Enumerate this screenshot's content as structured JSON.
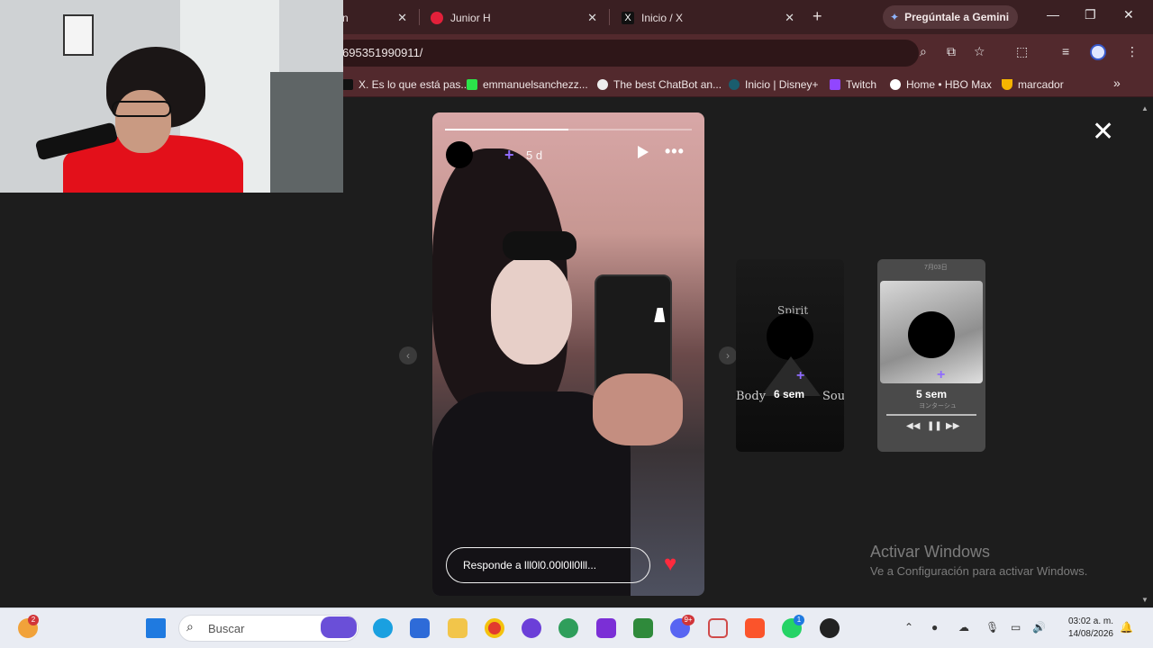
{
  "browser": {
    "tabs": [
      {
        "label": "n"
      },
      {
        "label": "Junior H"
      },
      {
        "label": "Inicio / X"
      }
    ],
    "new_tab_label": "+",
    "gemini_label": "Pregúntale a Gemini",
    "address": "695351990911/",
    "bookmarks": [
      {
        "label": "X. Es lo que está pas..."
      },
      {
        "label": "emmanuelsanchezz..."
      },
      {
        "label": "The best ChatBot an..."
      },
      {
        "label": "Inicio | Disney+"
      },
      {
        "label": "Twitch"
      },
      {
        "label": "Home • HBO Max"
      },
      {
        "label": "marcador"
      }
    ],
    "overflow_label": "»"
  },
  "story": {
    "progress": 0.5,
    "time": "5 d",
    "reply_placeholder": "Responde a lll0l0.00l0ll0lll...",
    "close_label": "✕"
  },
  "thumbnails": [
    {
      "time": "6 sem",
      "labels": {
        "top": "Spirit",
        "left": "Body",
        "right": "Soul"
      }
    },
    {
      "time": "5 sem",
      "header": "7月03日",
      "subtitle": "ヨンターシュ"
    }
  ],
  "watermark": {
    "title": "Activar Windows",
    "subtitle": "Ve a Configuración para activar Windows."
  },
  "taskbar": {
    "search_placeholder": "Buscar",
    "weather_badge": "2",
    "discord_badge": "9+",
    "whatsapp_badge": "1",
    "time": "03:02 a. m.",
    "date": "14/08/2026"
  }
}
